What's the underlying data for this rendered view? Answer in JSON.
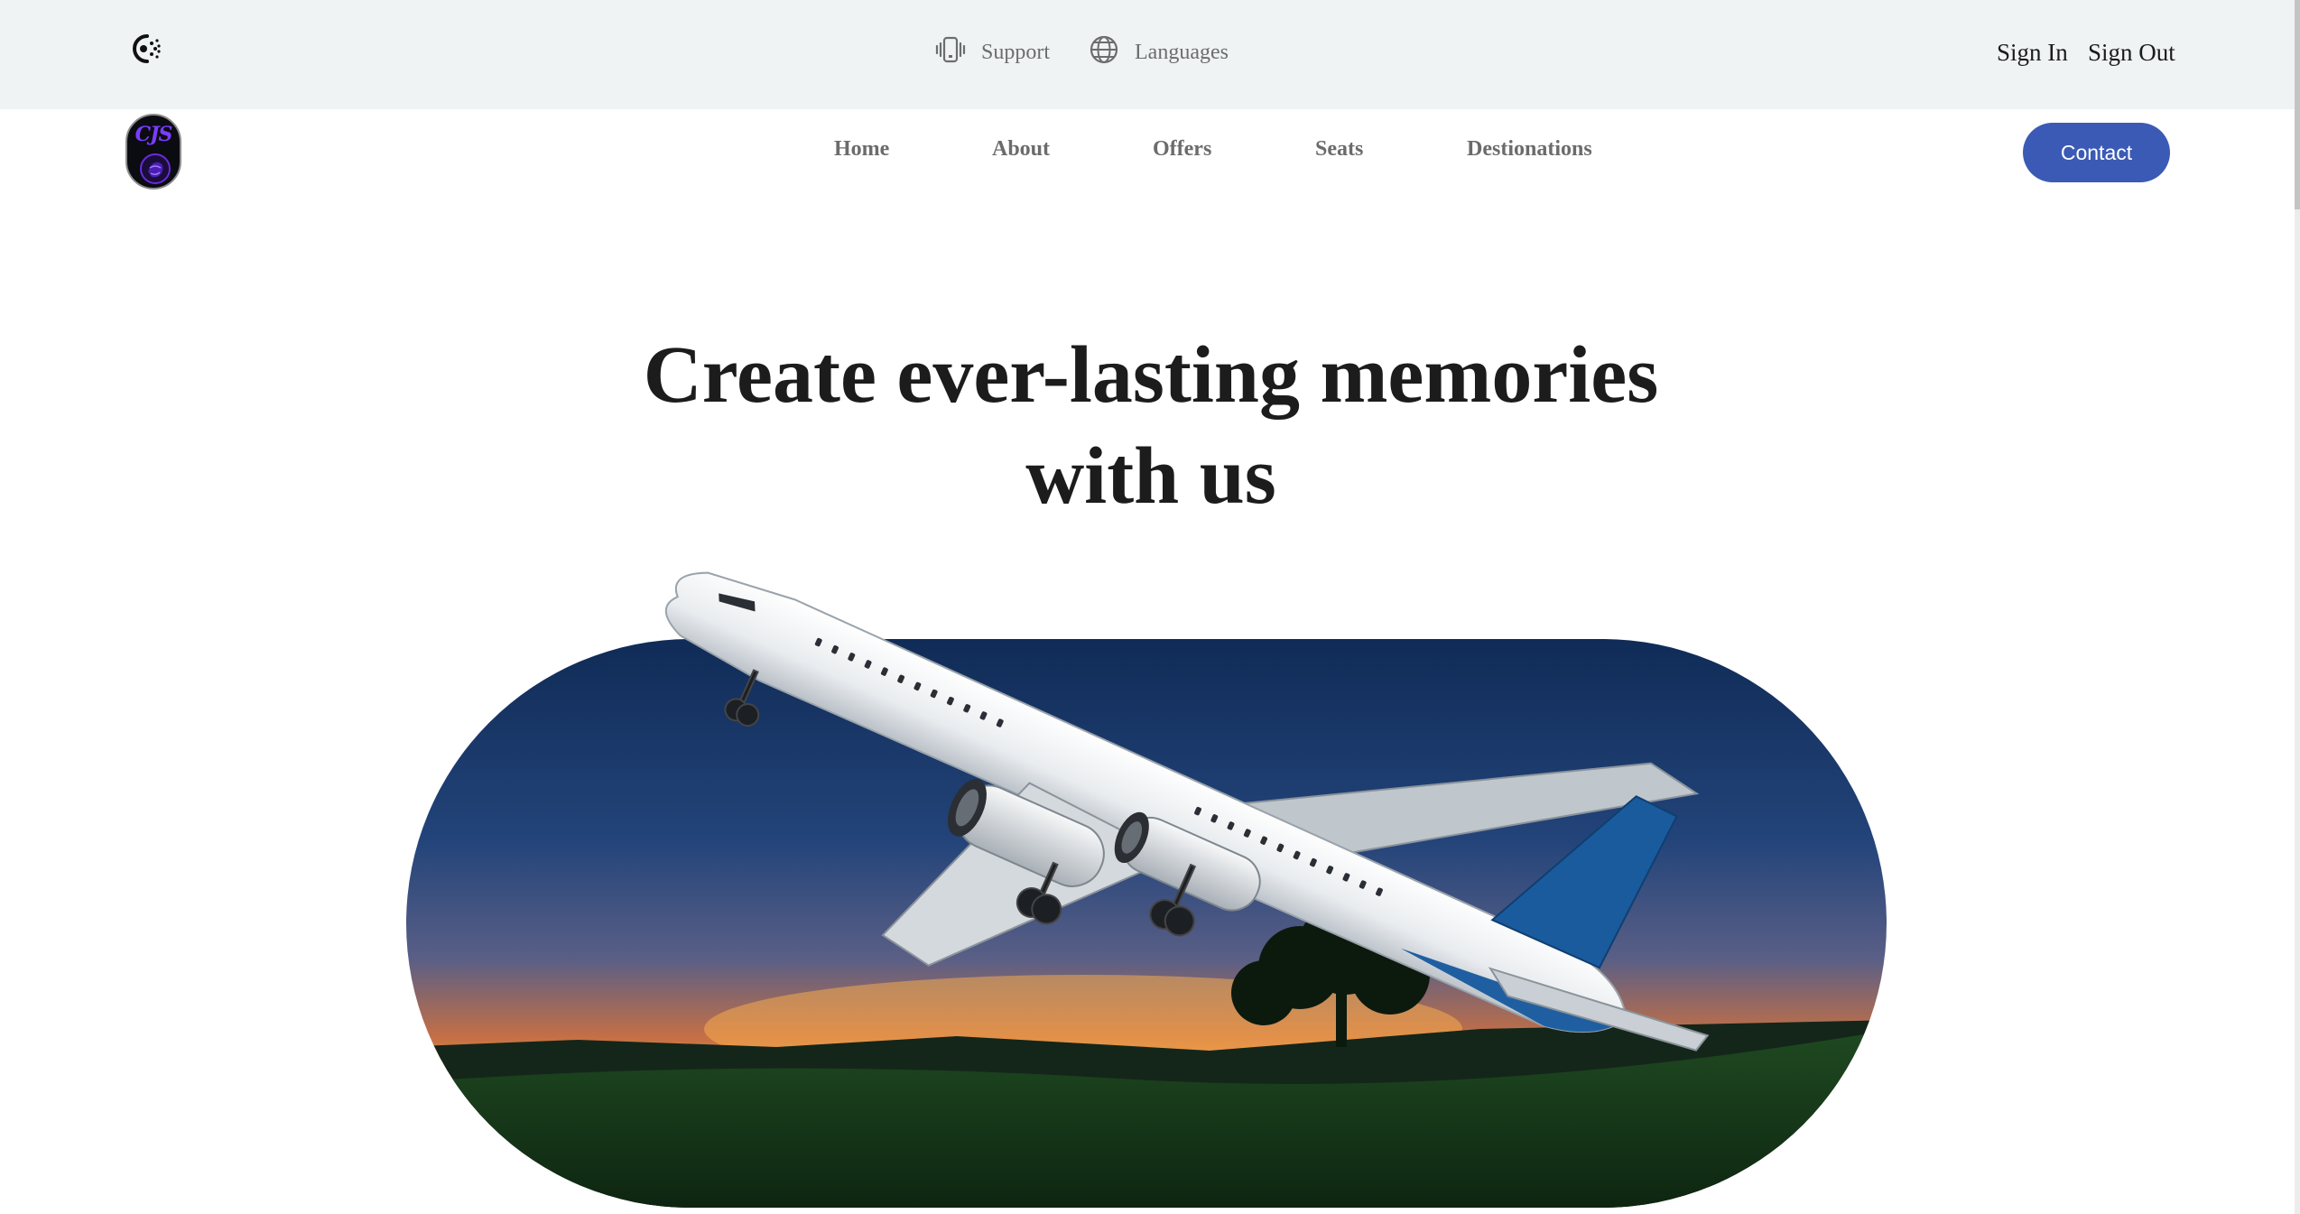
{
  "topbar": {
    "support_label": "Support",
    "languages_label": "Languages",
    "sign_in_label": "Sign In",
    "sign_out_label": "Sign Out"
  },
  "logo": {
    "text": "CJS"
  },
  "nav": {
    "items": [
      {
        "label": "Home"
      },
      {
        "label": "About"
      },
      {
        "label": "Offers"
      },
      {
        "label": "Seats"
      },
      {
        "label": "Destionations"
      }
    ],
    "contact_label": "Contact"
  },
  "hero": {
    "title_line1": "Create ever-lasting memories",
    "title_line2": "with us"
  },
  "colors": {
    "topbar_bg": "#f0f3f4",
    "accent": "#3b5ab5",
    "text_dark": "#1c1c1c",
    "nav_text": "#6b6b6b"
  },
  "icons": {
    "brand": "dotted-c-icon",
    "support": "vibrating-phone-icon",
    "languages": "globe-icon"
  }
}
